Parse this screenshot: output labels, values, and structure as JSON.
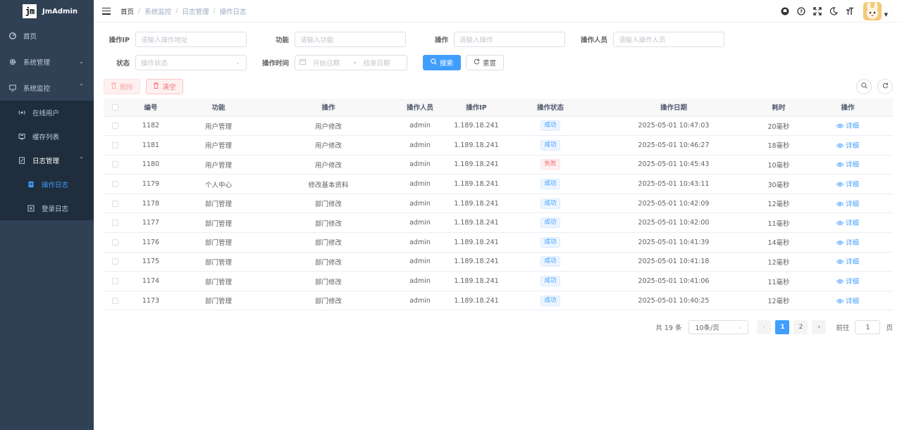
{
  "app": {
    "logo_text": "jm",
    "title": "JmAdmin"
  },
  "sidebar": {
    "items": [
      {
        "label": "首页",
        "icon": "dashboard-icon"
      },
      {
        "label": "系统管理",
        "icon": "gear-icon"
      },
      {
        "label": "系统监控",
        "icon": "monitor-icon"
      },
      {
        "label": "在线用户",
        "icon": "online-icon"
      },
      {
        "label": "缓存列表",
        "icon": "redis-icon"
      },
      {
        "label": "日志管理",
        "icon": "log-icon"
      },
      {
        "label": "操作日志",
        "icon": "form-icon"
      },
      {
        "label": "登录日志",
        "icon": "logininfor-icon"
      }
    ]
  },
  "breadcrumb": [
    "首页",
    "系统监控",
    "日志管理",
    "操作日志"
  ],
  "search": {
    "ip_label": "操作IP",
    "ip_placeholder": "请输入操作地址",
    "func_label": "功能",
    "func_placeholder": "请输入功能",
    "op_label": "操作",
    "op_placeholder": "请输入操作",
    "user_label": "操作人员",
    "user_placeholder": "请输入操作人员",
    "status_label": "状态",
    "status_placeholder": "操作状态",
    "time_label": "操作时间",
    "start_placeholder": "开始日期",
    "range_sep": "-",
    "end_placeholder": "结束日期",
    "search_btn": "搜索",
    "reset_btn": "重置"
  },
  "toolbar": {
    "delete_btn": "删除",
    "clear_btn": "清空"
  },
  "table": {
    "headers": [
      "编号",
      "功能",
      "操作",
      "操作人员",
      "操作IP",
      "操作状态",
      "操作日期",
      "耗时",
      "操作"
    ],
    "detail_label": "详细",
    "rows": [
      {
        "id": "1182",
        "func": "用户管理",
        "op": "用户修改",
        "user": "admin",
        "ip": "1.189.18.241",
        "status": "成功",
        "ok": true,
        "date": "2025-05-01 10:47:03",
        "cost": "20毫秒"
      },
      {
        "id": "1181",
        "func": "用户管理",
        "op": "用户修改",
        "user": "admin",
        "ip": "1.189.18.241",
        "status": "成功",
        "ok": true,
        "date": "2025-05-01 10:46:27",
        "cost": "18毫秒"
      },
      {
        "id": "1180",
        "func": "用户管理",
        "op": "用户修改",
        "user": "admin",
        "ip": "1.189.18.241",
        "status": "失败",
        "ok": false,
        "date": "2025-05-01 10:45:43",
        "cost": "10毫秒"
      },
      {
        "id": "1179",
        "func": "个人中心",
        "op": "修改基本资料",
        "user": "admin",
        "ip": "1.189.18.241",
        "status": "成功",
        "ok": true,
        "date": "2025-05-01 10:43:11",
        "cost": "30毫秒"
      },
      {
        "id": "1178",
        "func": "部门管理",
        "op": "部门修改",
        "user": "admin",
        "ip": "1.189.18.241",
        "status": "成功",
        "ok": true,
        "date": "2025-05-01 10:42:09",
        "cost": "12毫秒"
      },
      {
        "id": "1177",
        "func": "部门管理",
        "op": "部门修改",
        "user": "admin",
        "ip": "1.189.18.241",
        "status": "成功",
        "ok": true,
        "date": "2025-05-01 10:42:00",
        "cost": "11毫秒"
      },
      {
        "id": "1176",
        "func": "部门管理",
        "op": "部门修改",
        "user": "admin",
        "ip": "1.189.18.241",
        "status": "成功",
        "ok": true,
        "date": "2025-05-01 10:41:39",
        "cost": "14毫秒"
      },
      {
        "id": "1175",
        "func": "部门管理",
        "op": "部门修改",
        "user": "admin",
        "ip": "1.189.18.241",
        "status": "成功",
        "ok": true,
        "date": "2025-05-01 10:41:18",
        "cost": "12毫秒"
      },
      {
        "id": "1174",
        "func": "部门管理",
        "op": "部门修改",
        "user": "admin",
        "ip": "1.189.18.241",
        "status": "成功",
        "ok": true,
        "date": "2025-05-01 10:41:06",
        "cost": "11毫秒"
      },
      {
        "id": "1173",
        "func": "部门管理",
        "op": "部门修改",
        "user": "admin",
        "ip": "1.189.18.241",
        "status": "成功",
        "ok": true,
        "date": "2025-05-01 10:40:25",
        "cost": "12毫秒"
      }
    ]
  },
  "pagination": {
    "total": "共 19 条",
    "page_size": "10条/页",
    "pages": [
      "1",
      "2"
    ],
    "goto_label": "前往",
    "goto_value": "1",
    "page_suffix": "页"
  },
  "colors": {
    "primary": "#409eff",
    "sidebar_bg": "#304156",
    "danger": "#f56c6c"
  }
}
